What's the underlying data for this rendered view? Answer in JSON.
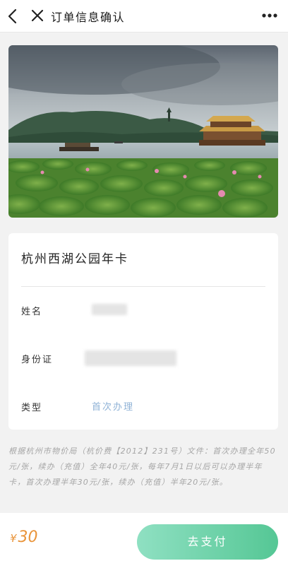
{
  "header": {
    "title": "订单信息确认",
    "icons": [
      "chevron-left-icon",
      "close-icon",
      "more-icon"
    ]
  },
  "product": {
    "title": "杭州西湖公园年卡"
  },
  "form": {
    "name_label": "姓名",
    "id_label": "身份证",
    "type_label": "类型",
    "type_value": "首次办理"
  },
  "notice": "根据杭州市物价局（杭价费【2012】231号）文件：首次办理全年50元/张，续办（充值）全年40元/张，每年7月1日以后可以办理半年卡，首次办理半年30元/张，续办（充值）半年20元/张。",
  "footer": {
    "currency": "¥",
    "amount": "30",
    "pay_label": "去支付"
  },
  "colors": {
    "accent_green": "#55c795",
    "price_orange": "#e9943a",
    "link_blue": "#8fb2d6"
  }
}
